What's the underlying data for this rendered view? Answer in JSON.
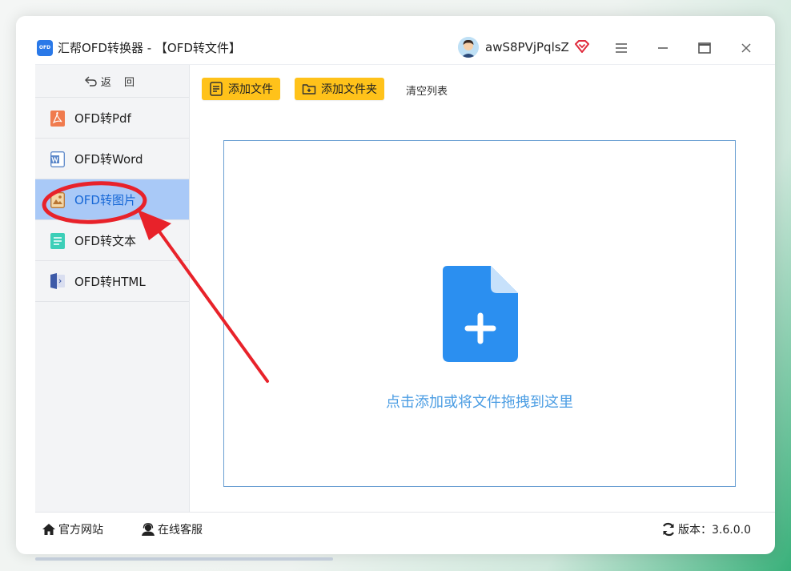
{
  "window": {
    "app_title": "汇帮OFD转换器 - 【OFD转文件】",
    "logo_text": "OFD",
    "username": "awS8PVjPqlsZ"
  },
  "sidebar": {
    "back_label": "返 回",
    "items": [
      {
        "label": "OFD转Pdf",
        "icon": "pdf-icon",
        "active": false
      },
      {
        "label": "OFD转Word",
        "icon": "word-icon",
        "active": false
      },
      {
        "label": "OFD转图片",
        "icon": "image-icon",
        "active": true
      },
      {
        "label": "OFD转文本",
        "icon": "text-icon",
        "active": false
      },
      {
        "label": "OFD转HTML",
        "icon": "html-icon",
        "active": false
      }
    ]
  },
  "toolbar": {
    "add_file_label": "添加文件",
    "add_folder_label": "添加文件夹",
    "clear_list_label": "清空列表"
  },
  "dropzone": {
    "text": "点击添加或将文件拖拽到这里"
  },
  "footer": {
    "website_label": "官方网站",
    "support_label": "在线客服",
    "version_label": "版本：3.6.0.0"
  },
  "colors": {
    "accent": "#ffc21a",
    "active_bg": "#a9c9f7",
    "active_text": "#1667d6",
    "drop_icon": "#2b8ff0",
    "annotation": "#e8222a"
  }
}
